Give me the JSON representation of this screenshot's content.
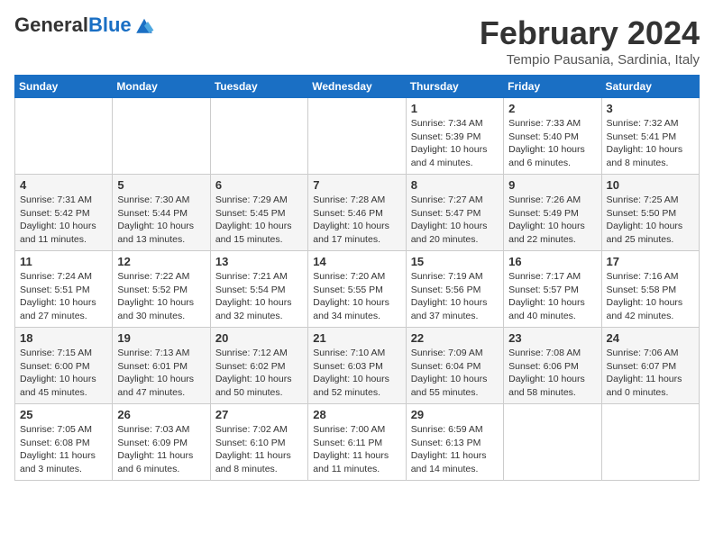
{
  "header": {
    "logo_general": "General",
    "logo_blue": "Blue",
    "month_title": "February 2024",
    "subtitle": "Tempio Pausania, Sardinia, Italy"
  },
  "days_of_week": [
    "Sunday",
    "Monday",
    "Tuesday",
    "Wednesday",
    "Thursday",
    "Friday",
    "Saturday"
  ],
  "weeks": [
    [
      {
        "day": "",
        "info": ""
      },
      {
        "day": "",
        "info": ""
      },
      {
        "day": "",
        "info": ""
      },
      {
        "day": "",
        "info": ""
      },
      {
        "day": "1",
        "info": "Sunrise: 7:34 AM\nSunset: 5:39 PM\nDaylight: 10 hours\nand 4 minutes."
      },
      {
        "day": "2",
        "info": "Sunrise: 7:33 AM\nSunset: 5:40 PM\nDaylight: 10 hours\nand 6 minutes."
      },
      {
        "day": "3",
        "info": "Sunrise: 7:32 AM\nSunset: 5:41 PM\nDaylight: 10 hours\nand 8 minutes."
      }
    ],
    [
      {
        "day": "4",
        "info": "Sunrise: 7:31 AM\nSunset: 5:42 PM\nDaylight: 10 hours\nand 11 minutes."
      },
      {
        "day": "5",
        "info": "Sunrise: 7:30 AM\nSunset: 5:44 PM\nDaylight: 10 hours\nand 13 minutes."
      },
      {
        "day": "6",
        "info": "Sunrise: 7:29 AM\nSunset: 5:45 PM\nDaylight: 10 hours\nand 15 minutes."
      },
      {
        "day": "7",
        "info": "Sunrise: 7:28 AM\nSunset: 5:46 PM\nDaylight: 10 hours\nand 17 minutes."
      },
      {
        "day": "8",
        "info": "Sunrise: 7:27 AM\nSunset: 5:47 PM\nDaylight: 10 hours\nand 20 minutes."
      },
      {
        "day": "9",
        "info": "Sunrise: 7:26 AM\nSunset: 5:49 PM\nDaylight: 10 hours\nand 22 minutes."
      },
      {
        "day": "10",
        "info": "Sunrise: 7:25 AM\nSunset: 5:50 PM\nDaylight: 10 hours\nand 25 minutes."
      }
    ],
    [
      {
        "day": "11",
        "info": "Sunrise: 7:24 AM\nSunset: 5:51 PM\nDaylight: 10 hours\nand 27 minutes."
      },
      {
        "day": "12",
        "info": "Sunrise: 7:22 AM\nSunset: 5:52 PM\nDaylight: 10 hours\nand 30 minutes."
      },
      {
        "day": "13",
        "info": "Sunrise: 7:21 AM\nSunset: 5:54 PM\nDaylight: 10 hours\nand 32 minutes."
      },
      {
        "day": "14",
        "info": "Sunrise: 7:20 AM\nSunset: 5:55 PM\nDaylight: 10 hours\nand 34 minutes."
      },
      {
        "day": "15",
        "info": "Sunrise: 7:19 AM\nSunset: 5:56 PM\nDaylight: 10 hours\nand 37 minutes."
      },
      {
        "day": "16",
        "info": "Sunrise: 7:17 AM\nSunset: 5:57 PM\nDaylight: 10 hours\nand 40 minutes."
      },
      {
        "day": "17",
        "info": "Sunrise: 7:16 AM\nSunset: 5:58 PM\nDaylight: 10 hours\nand 42 minutes."
      }
    ],
    [
      {
        "day": "18",
        "info": "Sunrise: 7:15 AM\nSunset: 6:00 PM\nDaylight: 10 hours\nand 45 minutes."
      },
      {
        "day": "19",
        "info": "Sunrise: 7:13 AM\nSunset: 6:01 PM\nDaylight: 10 hours\nand 47 minutes."
      },
      {
        "day": "20",
        "info": "Sunrise: 7:12 AM\nSunset: 6:02 PM\nDaylight: 10 hours\nand 50 minutes."
      },
      {
        "day": "21",
        "info": "Sunrise: 7:10 AM\nSunset: 6:03 PM\nDaylight: 10 hours\nand 52 minutes."
      },
      {
        "day": "22",
        "info": "Sunrise: 7:09 AM\nSunset: 6:04 PM\nDaylight: 10 hours\nand 55 minutes."
      },
      {
        "day": "23",
        "info": "Sunrise: 7:08 AM\nSunset: 6:06 PM\nDaylight: 10 hours\nand 58 minutes."
      },
      {
        "day": "24",
        "info": "Sunrise: 7:06 AM\nSunset: 6:07 PM\nDaylight: 11 hours\nand 0 minutes."
      }
    ],
    [
      {
        "day": "25",
        "info": "Sunrise: 7:05 AM\nSunset: 6:08 PM\nDaylight: 11 hours\nand 3 minutes."
      },
      {
        "day": "26",
        "info": "Sunrise: 7:03 AM\nSunset: 6:09 PM\nDaylight: 11 hours\nand 6 minutes."
      },
      {
        "day": "27",
        "info": "Sunrise: 7:02 AM\nSunset: 6:10 PM\nDaylight: 11 hours\nand 8 minutes."
      },
      {
        "day": "28",
        "info": "Sunrise: 7:00 AM\nSunset: 6:11 PM\nDaylight: 11 hours\nand 11 minutes."
      },
      {
        "day": "29",
        "info": "Sunrise: 6:59 AM\nSunset: 6:13 PM\nDaylight: 11 hours\nand 14 minutes."
      },
      {
        "day": "",
        "info": ""
      },
      {
        "day": "",
        "info": ""
      }
    ]
  ]
}
